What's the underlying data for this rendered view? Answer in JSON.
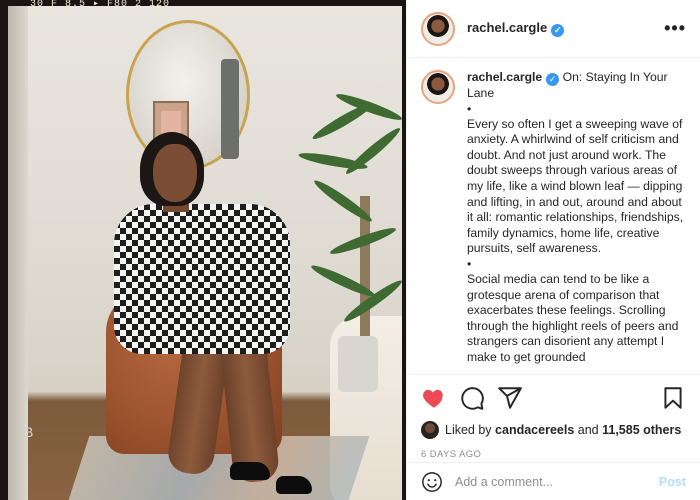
{
  "photo": {
    "film_text": "30 F 8.5  ▸ F80 2 120",
    "corner_mark": "B"
  },
  "header": {
    "username": "rachel.cargle",
    "verified_glyph": "✓",
    "more_glyph": "•••"
  },
  "caption": {
    "username": "rachel.cargle",
    "verified_glyph": "✓",
    "title": "On: Staying In Your Lane",
    "bullet": "•",
    "paragraph1": "Every so often I get a sweeping wave of anxiety. A whirlwind of self criticism and doubt. And not just around work. The doubt sweeps through various areas of my life, like a wind blown leaf — dipping and lifting, in and out, around and about it all: romantic relationships, friendships, family dynamics, home life, creative pursuits, self awareness.",
    "paragraph2": "Social media can tend to be like a grotesque arena of comparison that exacerbates these feelings. Scrolling through the highlight reels of peers and strangers can disorient any attempt I make to get grounded"
  },
  "actions": {
    "icons": [
      "heart-filled-icon",
      "comment-icon",
      "share-icon",
      "bookmark-icon"
    ],
    "heart_color": "#ed4956"
  },
  "likes": {
    "prefix": "Liked by",
    "user": "candacereels",
    "joiner": "and",
    "count": "11,585 others"
  },
  "timestamp": "6 DAYS AGO",
  "comment": {
    "placeholder": "Add a comment...",
    "post_label": "Post",
    "post_color": "#b2dffc"
  }
}
